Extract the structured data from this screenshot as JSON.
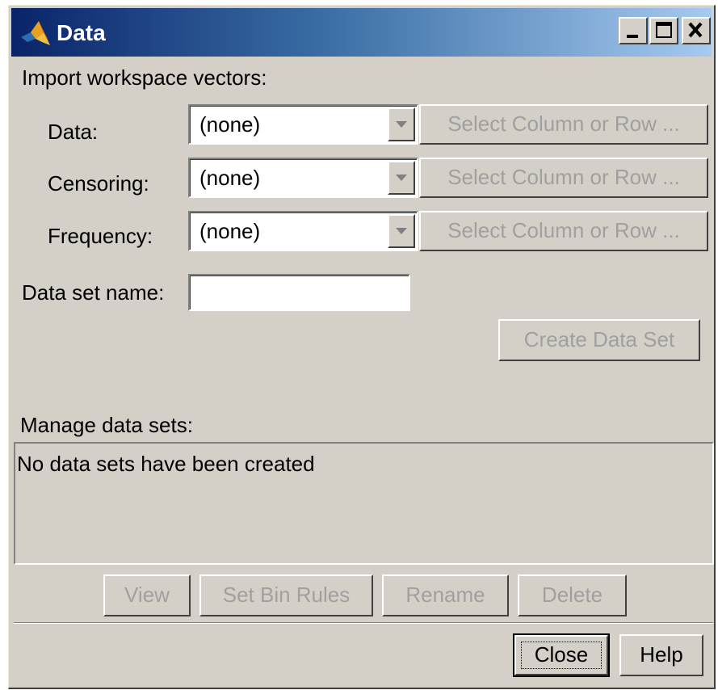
{
  "window": {
    "title": "Data",
    "icon": "matlab-logo-icon"
  },
  "import_section": {
    "heading": "Import workspace vectors:",
    "rows": [
      {
        "label": "Data:",
        "combo_value": "(none)",
        "select_button": "Select Column or Row ..."
      },
      {
        "label": "Censoring:",
        "combo_value": "(none)",
        "select_button": "Select Column or Row ..."
      },
      {
        "label": "Frequency:",
        "combo_value": "(none)",
        "select_button": "Select Column or Row ..."
      }
    ],
    "dataset_name_label": "Data set name:",
    "dataset_name_value": "",
    "create_button": "Create Data Set"
  },
  "manage_section": {
    "heading": "Manage data sets:",
    "list_message": "No data sets have been created",
    "buttons": {
      "view": "View",
      "set_bin_rules": "Set Bin Rules",
      "rename": "Rename",
      "delete": "Delete"
    }
  },
  "footer": {
    "close": "Close",
    "help": "Help"
  },
  "colors": {
    "face": "#d4d0c8",
    "title_start": "#0a246a",
    "title_end": "#a6caf0",
    "disabled_text": "#a0a0a0"
  }
}
